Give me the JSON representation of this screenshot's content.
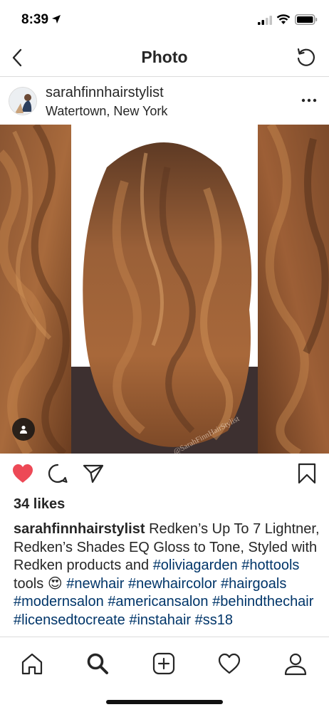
{
  "status_bar": {
    "time": "8:39"
  },
  "nav": {
    "title": "Photo"
  },
  "post": {
    "username": "sarahfinnhairstylist",
    "location": "Watertown, New York",
    "watermark": "@SarahFinnHairStylist",
    "likes": "34 likes",
    "caption": {
      "user": "sarahfinnhairstylist",
      "text1": " Redken’s Up To 7 Lightner, Redken’s Shades EQ Gloss to Tone, Styled with Redken products and ",
      "tags1": [
        "#oliviagarden",
        "#hottools"
      ],
      "text2": " tools ",
      "emoji": "😍",
      "tags2": [
        "#newhair",
        "#newhaircolor",
        "#hairgoals",
        "#modernsalon",
        "#americansalon",
        "#behindthechair",
        "#licensedtocreate",
        "#instahair",
        "#ss18"
      ]
    }
  },
  "icons": {
    "back": "chevron-left-icon",
    "refresh": "refresh-icon",
    "more": "more-horizontal-icon",
    "like": "heart-filled-icon",
    "comment": "comment-icon",
    "share": "paper-plane-icon",
    "save": "bookmark-icon",
    "user_tag": "person-icon",
    "tabs": [
      "home-icon",
      "search-icon",
      "add-icon",
      "heart-icon",
      "profile-icon"
    ]
  },
  "colors": {
    "like_red": "#ed4956",
    "hashtag": "#003569",
    "text": "#262626"
  }
}
